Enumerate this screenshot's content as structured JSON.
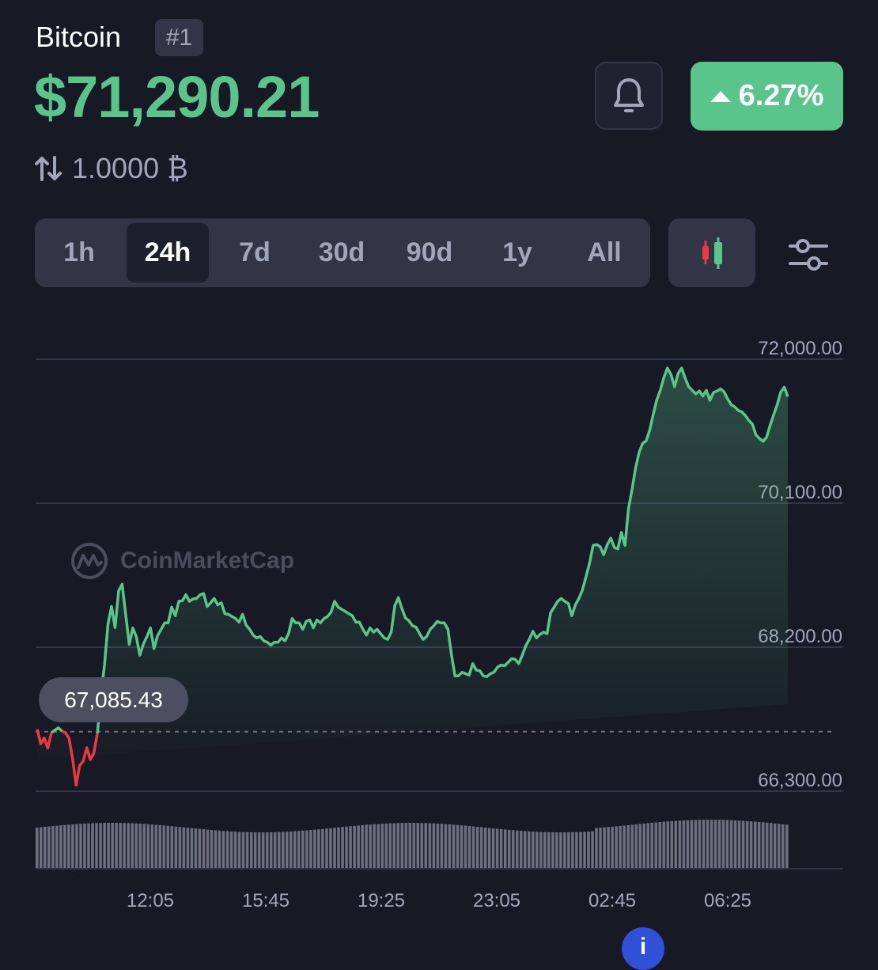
{
  "coin": {
    "name": "Bitcoin",
    "rank": "#1",
    "price": "$71,290.21",
    "change_percent": "6.27%",
    "change_direction": "up",
    "conversion": "1.0000 ₿"
  },
  "toolbar": {
    "tabs": [
      {
        "label": "1h",
        "active": false
      },
      {
        "label": "24h",
        "active": true
      },
      {
        "label": "7d",
        "active": false
      },
      {
        "label": "30d",
        "active": false
      },
      {
        "label": "90d",
        "active": false
      },
      {
        "label": "1y",
        "active": false
      },
      {
        "label": "All",
        "active": false
      }
    ],
    "candle_icon": "candlestick-icon",
    "settings_icon": "sliders-icon",
    "bell_icon": "bell-icon"
  },
  "watermark": "CoinMarketCap",
  "open_price_label": "67,085.43",
  "colors": {
    "background": "#171924",
    "up": "#5ac58a",
    "down": "#ea3943",
    "panel": "#323546",
    "muted_text": "#a1a7bb"
  },
  "chart_data": {
    "type": "area",
    "y_ticks": [
      "72,000.00",
      "70,100.00",
      "68,200.00",
      "66,300.00"
    ],
    "y_tick_values": [
      72000,
      70100,
      68200,
      66300
    ],
    "x_ticks": [
      "12:05",
      "15:45",
      "19:25",
      "23:05",
      "02:45",
      "06:25"
    ],
    "ylim": [
      66300,
      72000
    ],
    "reference_price": 67085.43,
    "series": [
      {
        "values": [
          67116,
          66925,
          67000,
          66868,
          67070,
          67106,
          67136,
          67092,
          67073,
          66997,
          66725,
          66378,
          66638,
          66694,
          66875,
          66718,
          66802,
          67062,
          67566,
          67964,
          68505,
          68738,
          68459,
          68943,
          69031,
          68634,
          68237,
          68455,
          68341,
          68095,
          68242,
          68341,
          68455,
          68182,
          68351,
          68436,
          68521,
          68521,
          68729,
          68615,
          68805,
          68813,
          68892,
          68805,
          68837,
          68843,
          68890,
          68909,
          68738,
          68786,
          68843,
          68758,
          68786,
          68643,
          68634,
          68605,
          68580,
          68530,
          68634,
          68492,
          68436,
          68360,
          68322,
          68341,
          68284,
          68265,
          68227,
          68265,
          68265,
          68322,
          68284,
          68379,
          68578,
          68521,
          68521,
          68436,
          68541,
          68560,
          68455,
          68559,
          68521,
          68578,
          68605,
          68662,
          68805,
          68729,
          68700,
          68672,
          68643,
          68615,
          68530,
          68530,
          68436,
          68360,
          68455,
          68398,
          68436,
          68379,
          68322,
          68303,
          68398,
          68747,
          68853,
          68710,
          68587,
          68549,
          68483,
          68464,
          68379,
          68303,
          68341,
          68436,
          68483,
          68540,
          68521,
          68521,
          68436,
          68104,
          67822,
          67822,
          67869,
          67850,
          67831,
          67983,
          67898,
          67889,
          67822,
          67812,
          67850,
          67870,
          67936,
          67964,
          67955,
          68001,
          68049,
          68040,
          67983,
          68096,
          68219,
          68303,
          68411,
          68322,
          68369,
          68398,
          68379,
          68653,
          68729,
          68805,
          68843,
          68805,
          68777,
          68615,
          68758,
          68843,
          68957,
          69128,
          69308,
          69544,
          69554,
          69526,
          69420,
          69553,
          69639,
          69515,
          69498,
          69715,
          69544,
          70032,
          70278,
          70563,
          70771,
          70892,
          70922,
          71065,
          71276,
          71466,
          71590,
          71760,
          71883,
          71797,
          71637,
          71810,
          71883,
          71751,
          71637,
          71590,
          71542,
          71580,
          71513,
          71590,
          71457,
          71561,
          71580,
          71608,
          71570,
          71476,
          71400,
          71372,
          71323,
          71305,
          71258,
          71191,
          71144,
          71001,
          70954,
          70916,
          70970,
          71125,
          71267,
          71400,
          71566,
          71630,
          71505
        ]
      }
    ],
    "grid": true
  }
}
